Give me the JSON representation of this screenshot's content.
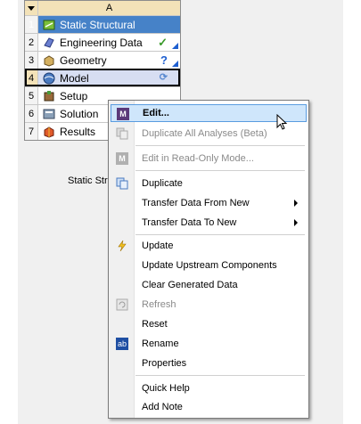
{
  "system": {
    "column_header": "A",
    "rows": [
      {
        "num": "1",
        "label": "Static Structural",
        "icon": "static-structural-icon",
        "status": ""
      },
      {
        "num": "2",
        "label": "Engineering Data",
        "icon": "engineering-data-icon",
        "status": "✓"
      },
      {
        "num": "3",
        "label": "Geometry",
        "icon": "geometry-icon",
        "status": "?"
      },
      {
        "num": "4",
        "label": "Model",
        "icon": "model-icon",
        "status": "⟳"
      },
      {
        "num": "5",
        "label": "Setup",
        "icon": "setup-icon",
        "status": ""
      },
      {
        "num": "6",
        "label": "Solution",
        "icon": "solution-icon",
        "status": ""
      },
      {
        "num": "7",
        "label": "Results",
        "icon": "results-icon",
        "status": ""
      }
    ],
    "caption": "Static Str"
  },
  "context_menu": {
    "items": [
      {
        "label": "Edit...",
        "icon": "M"
      },
      {
        "label": "Duplicate All Analyses (Beta)"
      },
      {
        "label": "Edit in Read-Only Mode...",
        "icon": "M"
      },
      {
        "label": "Duplicate"
      },
      {
        "label": "Transfer Data From New"
      },
      {
        "label": "Transfer Data To New"
      },
      {
        "label": "Update"
      },
      {
        "label": "Update Upstream Components"
      },
      {
        "label": "Clear Generated Data"
      },
      {
        "label": "Refresh"
      },
      {
        "label": "Reset"
      },
      {
        "label": "Rename",
        "icon": "ab"
      },
      {
        "label": "Properties"
      },
      {
        "label": "Quick Help"
      },
      {
        "label": "Add Note"
      }
    ]
  },
  "colors": {
    "title_row": "#4682c8",
    "header_row": "#f3e2b8",
    "menu_hover": "#cfe6fb",
    "status_check": "#3a9a2a",
    "status_question": "#1e5fd0"
  }
}
